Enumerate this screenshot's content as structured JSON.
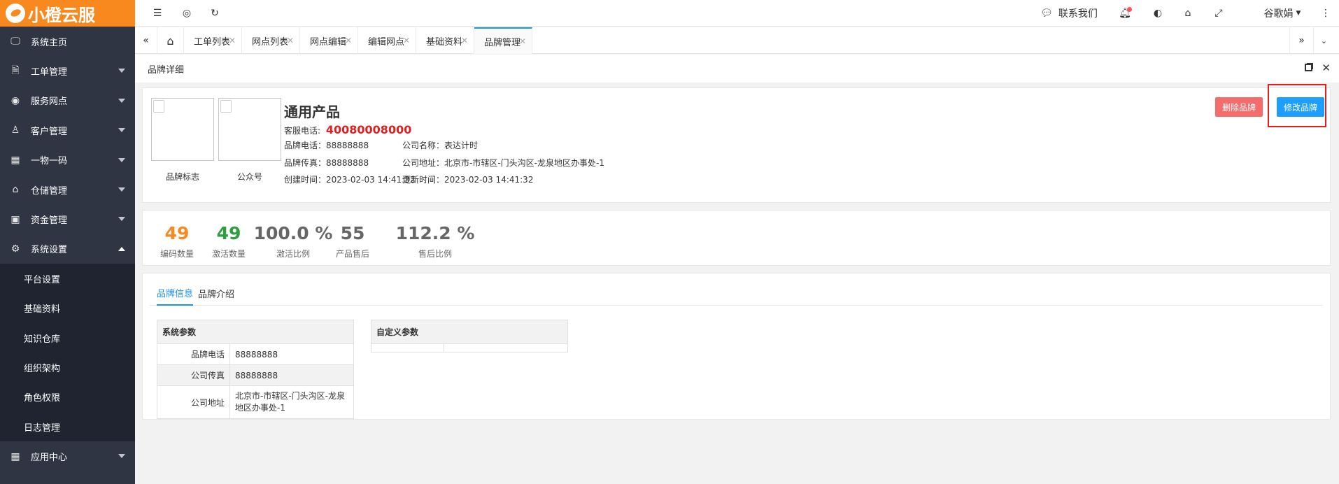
{
  "logo": {
    "text": "小橙云服"
  },
  "sidebar": {
    "items": [
      {
        "label": "系统主页",
        "icon": "monitor-icon",
        "glyph": "🖵"
      },
      {
        "label": "工单管理",
        "icon": "document-icon",
        "glyph": "🗎"
      },
      {
        "label": "服务网点",
        "icon": "globe-icon",
        "glyph": "◉"
      },
      {
        "label": "客户管理",
        "icon": "user-icon",
        "glyph": "♙"
      },
      {
        "label": "一物一码",
        "icon": "grid-icon",
        "glyph": "▦"
      },
      {
        "label": "仓储管理",
        "icon": "bank-icon",
        "glyph": "⌂"
      },
      {
        "label": "资金管理",
        "icon": "money-icon",
        "glyph": "▣"
      },
      {
        "label": "系统设置",
        "icon": "gear-icon",
        "glyph": "⚙"
      }
    ],
    "sub_items": [
      "平台设置",
      "基础资料",
      "知识仓库",
      "组织架构",
      "角色权限",
      "日志管理"
    ],
    "bottom_item": {
      "label": "应用中心",
      "icon": "apps-icon",
      "glyph": "▦"
    }
  },
  "topbar": {
    "contact": "联系我们",
    "user": "谷歌娟"
  },
  "tabs": [
    "工单列表",
    "网点列表",
    "网点编辑",
    "编辑网点",
    "基础资料",
    "品牌管理"
  ],
  "page": {
    "breadcrumb": "品牌详细"
  },
  "brand": {
    "name": "通用产品",
    "logo_label": "品牌标志",
    "qr_label": "公众号",
    "service_phone_label": "客服电话:",
    "service_phone": "40080008000",
    "brand_phone": "品牌电话：88888888",
    "brand_fax": "品牌传真：88888888",
    "created": "创建时间：2023-02-03 14:41:32",
    "company_name": "公司名称：表达计时",
    "company_address": "公司地址：北京市-市辖区-门头沟区-龙泉地区办事处-1",
    "updated": "更新时间：2023-02-03 14:41:32",
    "delete_button": "删除品牌",
    "edit_button": "修改品牌"
  },
  "stats": [
    {
      "value": "49",
      "label": "编码数量",
      "color": "#f7891e"
    },
    {
      "value": "49",
      "label": "激活数量",
      "color": "#2e9d3e"
    },
    {
      "value": "100.0 %",
      "label": "激活比例",
      "color": "#666666"
    },
    {
      "value": "55",
      "label": "产品售后",
      "color": "#666666"
    },
    {
      "value": "112.2 %",
      "label": "售后比例",
      "color": "#666666"
    }
  ],
  "detail_tabs": [
    "品牌信息",
    "品牌介绍"
  ],
  "system_params": {
    "header": "系统参数",
    "rows": [
      {
        "key": "品牌电话",
        "value": "88888888"
      },
      {
        "key": "公司传真",
        "value": "88888888"
      },
      {
        "key": "公司地址",
        "value": "北京市-市辖区-门头沟区-龙泉地区办事处-1"
      }
    ]
  },
  "custom_params": {
    "header": "自定义参数"
  },
  "colors": {
    "accent": "#1890ff",
    "brand_orange": "#f7891e",
    "danger": "#f56c6c",
    "primary_btn": "#1e9fff",
    "highlight": "#e02020"
  }
}
